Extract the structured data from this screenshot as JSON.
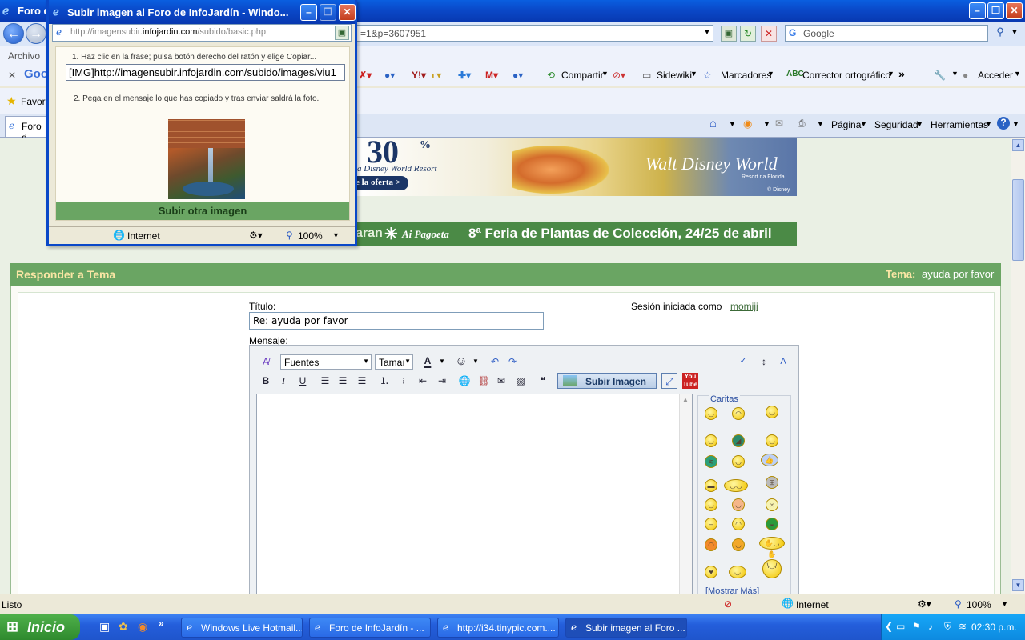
{
  "main_window": {
    "title": "Foro d",
    "address_partial": "=1&p=3607951",
    "search_placeholder": "Google"
  },
  "menu": {
    "archivo": "Archivo"
  },
  "toolbar": {
    "google_label": "Goo",
    "compartir": "Compartir",
    "sidewiki": "Sidewiki",
    "marcadores": "Marcadores",
    "corrector": "Corrector ortográfico",
    "more": "»",
    "acceder": "Acceder"
  },
  "favorites": {
    "label": "Favorit"
  },
  "tab": {
    "label": "Foro d"
  },
  "command_bar": {
    "pagina": "Página",
    "seguridad": "Seguridad",
    "herramientas": "Herramientas"
  },
  "banners": {
    "disney_percent": "30",
    "disney_text1": "a Disney World Resort",
    "disney_text2": "e la oferta >",
    "disney_logo": "Walt Disney World",
    "disney_sub": "Resort na Florida",
    "disney_copy": "© Disney",
    "feria_left": "aran",
    "feria_brand": "Ai Pagoeta",
    "feria_text": "8ª Feria de Plantas de Colección, 24/25 de abril"
  },
  "reply": {
    "header": "Responder a Tema",
    "tema_label": "Tema:",
    "tema_value": "ayuda por favor",
    "titulo_label": "Título:",
    "titulo_value": "Re: ayuda por favor",
    "session_text": "Sesión iniciada como",
    "session_user": "momiji",
    "mensaje_label": "Mensaje:"
  },
  "editor": {
    "font_select": "Fuentes",
    "size_select": "Tamaı",
    "upload_button": "Subir Imagen",
    "caritas_title": "Caritas",
    "show_more": "[Mostrar Más]"
  },
  "popup": {
    "title": "Subir imagen al Foro de InfoJardín - Windo...",
    "address_pre": "http://imagensubir.",
    "address_host": "infojardin.com",
    "address_post": "/subido/basic.php",
    "step1": "1. Haz clic en la frase; pulsa botón derecho del ratón y elige Copiar...",
    "img_code": "[IMG]http://imagensubir.infojardin.com/subido/images/viu1",
    "step2": "2. Pega en el mensaje lo que has copiado y tras enviar saldrá la foto.",
    "upload_again": "Subir otra imagen",
    "status_zone": "Internet",
    "status_zoom": "100%"
  },
  "status": {
    "left": "Listo",
    "zone": "Internet",
    "zoom": "100%"
  },
  "taskbar": {
    "start": "Inicio",
    "tasks": [
      "Windows Live Hotmail...",
      "Foro de InfoJardín - ...",
      "http://i34.tinypic.com....",
      "Subir imagen al Foro ..."
    ],
    "clock": "02:30 p.m."
  }
}
